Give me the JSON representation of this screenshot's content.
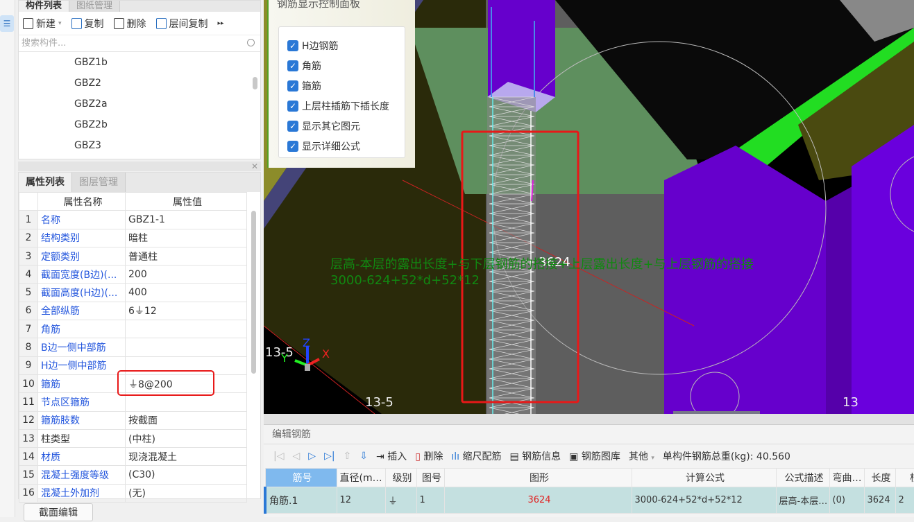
{
  "component_panel": {
    "tabs": [
      "构件列表",
      "图纸管理"
    ],
    "toolbar": {
      "new": "新建",
      "copy": "复制",
      "delete": "删除",
      "floor_copy": "层间复制"
    },
    "search_placeholder": "搜索构件...",
    "items": [
      "GBZ1b",
      "GBZ2",
      "GBZ2a",
      "GBZ2b",
      "GBZ3"
    ]
  },
  "property_panel": {
    "tabs": [
      "属性列表",
      "图层管理"
    ],
    "columns": [
      "属性名称",
      "属性值"
    ],
    "rows": [
      {
        "n": "1",
        "k": "名称",
        "v": "GBZ1-1"
      },
      {
        "n": "2",
        "k": "结构类别",
        "v": "暗柱"
      },
      {
        "n": "3",
        "k": "定额类别",
        "v": "普通柱"
      },
      {
        "n": "4",
        "k": "截面宽度(B边)(...",
        "v": "200"
      },
      {
        "n": "5",
        "k": "截面高度(H边)(...",
        "v": "400"
      },
      {
        "n": "6",
        "k": "全部纵筋",
        "v": "6⏚12"
      },
      {
        "n": "7",
        "k": "角筋",
        "v": ""
      },
      {
        "n": "8",
        "k": "B边一侧中部筋",
        "v": ""
      },
      {
        "n": "9",
        "k": "H边一侧中部筋",
        "v": ""
      },
      {
        "n": "10",
        "k": "箍筋",
        "v": "⏚8@200"
      },
      {
        "n": "11",
        "k": "节点区箍筋",
        "v": ""
      },
      {
        "n": "12",
        "k": "箍筋肢数",
        "v": "按截面"
      },
      {
        "n": "13",
        "k": "柱类型",
        "v": "(中柱)"
      },
      {
        "n": "14",
        "k": "材质",
        "v": "现浇混凝土"
      },
      {
        "n": "15",
        "k": "混凝土强度等级",
        "v": "(C30)"
      },
      {
        "n": "16",
        "k": "混凝土外加剂",
        "v": "(无)"
      }
    ],
    "section_edit": "截面编辑"
  },
  "display_panel": {
    "title": "钢筋显示控制面板",
    "options": [
      {
        "label": "H边钢筋",
        "checked": true
      },
      {
        "label": "角筋",
        "checked": true
      },
      {
        "label": "箍筋",
        "checked": true
      },
      {
        "label": "上层柱插筋下插长度",
        "checked": true
      },
      {
        "label": "显示其它图元",
        "checked": true
      },
      {
        "label": "显示详细公式",
        "checked": true
      }
    ]
  },
  "viewport": {
    "length_label": "3624",
    "formula_desc": "层高-本层的露出长度+与下层钢筋的搭接+上层露出长度+与上层钢筋的搭接",
    "formula": "3000-624+52*d+52*12",
    "axis_labels": [
      "13-5",
      "13-5",
      "13"
    ],
    "axes": {
      "x": "X",
      "y": "Y",
      "z": "Z"
    }
  },
  "rebar_editor": {
    "title": "编辑钢筋",
    "toolbar": {
      "insert": "插入",
      "delete": "删除",
      "scale": "缩尺配筋",
      "info": "钢筋信息",
      "library": "钢筋图库",
      "other": "其他",
      "total_label": "单构件钢筋总重(kg): 40.560"
    },
    "columns": [
      "筋号",
      "直径(mm)",
      "级别",
      "图号",
      "图形",
      "计算公式",
      "公式描述",
      "弯曲调整",
      "长度",
      "根"
    ],
    "rows": [
      {
        "idx": "1",
        "name": "角筋.1",
        "dia": "12",
        "grade": "⏚",
        "fig": "1",
        "shape": "3624",
        "formula": "3000-624+52*d+52*12",
        "desc": "层高-本层的露出...",
        "bend": "(0)",
        "len": "3624",
        "count": "2"
      }
    ]
  },
  "colors": {
    "highlight": "#e81818",
    "accent": "#2a78d6",
    "beam_purple": "#6600cc",
    "slab_green": "#22dd22"
  }
}
